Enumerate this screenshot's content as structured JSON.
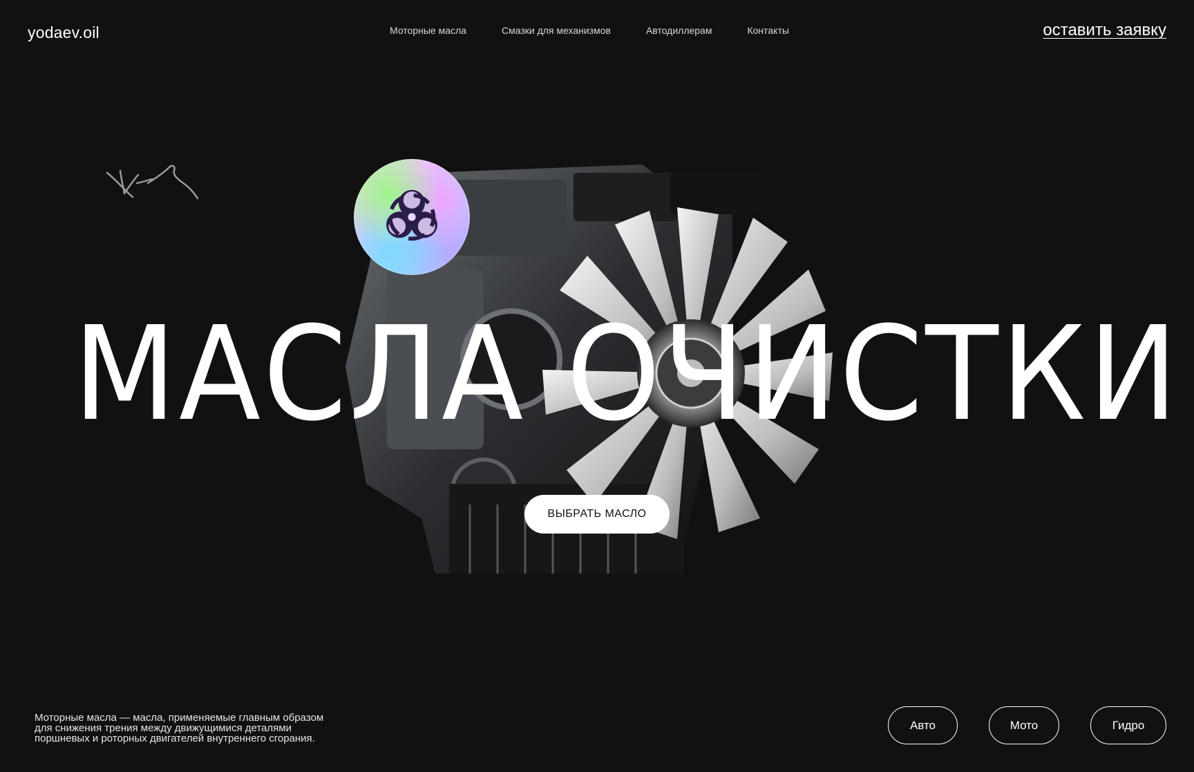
{
  "header": {
    "logo": "yodaev.oil",
    "nav": [
      {
        "label": "Моторные масла"
      },
      {
        "label": "Смазки для механизмов"
      },
      {
        "label": "Автодиллерам"
      },
      {
        "label": "Контакты"
      }
    ],
    "cta": "оставить заявку"
  },
  "hero": {
    "headline": "МАСЛА ОЧИСТКИ",
    "button": "ВЫБРАТЬ МАСЛО",
    "badge_icon": "biohazard-icon",
    "image": "engine-image",
    "signature": "signature-doodle"
  },
  "footer": {
    "description_lines": [
      "Моторные масла — масла, применяемые главным образом",
      "для снижения трения между движущимися деталями",
      "поршневых и роторных двигателей внутреннего сгорания."
    ],
    "filters": [
      {
        "label": "Авто"
      },
      {
        "label": "Мото"
      },
      {
        "label": "Гидро"
      }
    ]
  },
  "colors": {
    "background": "#111111",
    "text": "#ffffff",
    "button_bg": "#ffffff",
    "button_text": "#111111"
  }
}
